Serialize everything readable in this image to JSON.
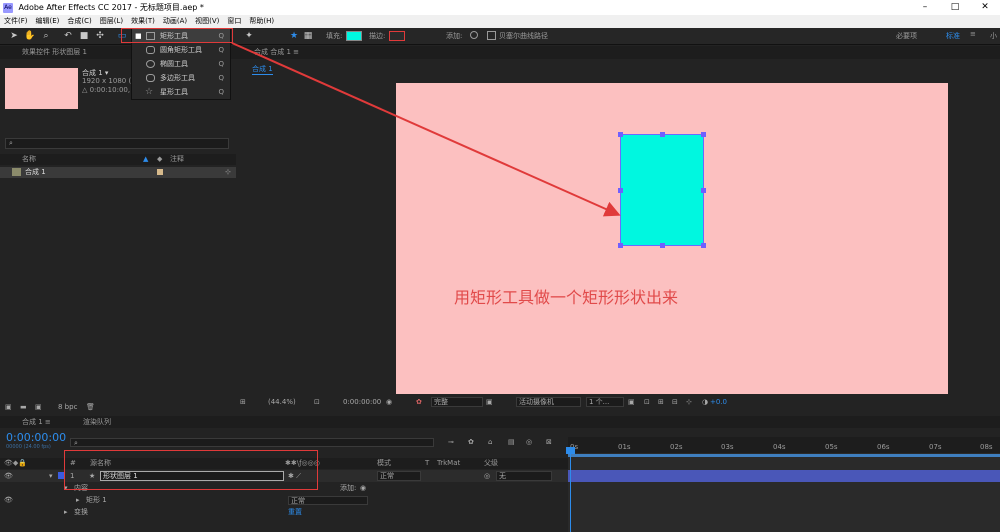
{
  "window": {
    "title": "Adobe After Effects CC 2017 - 无标题项目.aep *",
    "logo": "Ae"
  },
  "menu": [
    "文件(F)",
    "编辑(E)",
    "合成(C)",
    "图层(L)",
    "效果(T)",
    "动画(A)",
    "视图(V)",
    "窗口",
    "帮助(H)"
  ],
  "toolbar": {
    "add_label": "添加:",
    "fill_label": "填充:",
    "stroke_label": "描边:",
    "fill_color": "#00f7e0",
    "stroke_color": "#e03a3a",
    "bezier_label": "贝塞尔曲线路径",
    "workspace_essentials": "必要项",
    "workspace_standard": "标准",
    "workspace_small": "小"
  },
  "shape_menu": {
    "items": [
      {
        "label": "矩形工具",
        "key": "Q",
        "selected": true
      },
      {
        "label": "圆角矩形工具",
        "key": "Q",
        "selected": false
      },
      {
        "label": "椭圆工具",
        "key": "Q",
        "selected": false
      },
      {
        "label": "多边形工具",
        "key": "Q",
        "selected": false
      },
      {
        "label": "星形工具",
        "key": "Q",
        "selected": false
      }
    ]
  },
  "project": {
    "effects_tab": "效果控件 形状图层 1",
    "comp_name": "合成 1 ▾",
    "comp_size": "1920 x 1080 (1",
    "comp_time": "△ 0:00:10:00,",
    "col_name": "名称",
    "col_note": "注释",
    "item": "合成 1",
    "bpc": "8 bpc"
  },
  "composition": {
    "tab": "合成 合成 1",
    "breadcrumb": "合成 1",
    "zoom": "(44.4%)",
    "timecode": "0:00:00:00",
    "quality": "完整",
    "camera": "活动摄像机",
    "views": "1 个...",
    "offset": "+0.0",
    "annotation": "用矩形工具做一个矩形形状出来"
  },
  "timeline": {
    "tab": "合成 1",
    "render_tab": "渲染队列",
    "timecode": "0:00:00:00",
    "fps": "00000 (24.00 fps)",
    "col_num": "#",
    "col_source": "源名称",
    "col_mode": "模式",
    "col_trkmat": "TrkMat",
    "col_parent": "父级",
    "layer_num": "1",
    "layer_name": "形状图层 1",
    "layer_mode": "正常",
    "parent_value": "无",
    "add_label": "添加:",
    "contents": "内容",
    "rect": "矩形 1",
    "rect_mode": "正常",
    "transform": "变换",
    "reset": "重置",
    "ruler_marks": [
      "0s",
      "01s",
      "02s",
      "03s",
      "04s",
      "05s",
      "06s",
      "07s",
      "08s"
    ]
  }
}
